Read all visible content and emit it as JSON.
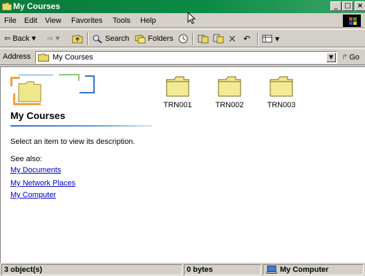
{
  "window": {
    "title": "My Courses"
  },
  "menu": [
    "File",
    "Edit",
    "View",
    "Favorites",
    "Tools",
    "Help"
  ],
  "toolbar": {
    "back": "Back",
    "search": "Search",
    "folders": "Folders"
  },
  "address": {
    "label": "Address",
    "value": "My Courses",
    "go": "Go"
  },
  "sidebar": {
    "title": "My Courses",
    "description": "Select an item to view its description.",
    "see_also": "See also:",
    "links": [
      "My Documents",
      "My Network Places",
      "My Computer"
    ]
  },
  "items": [
    {
      "label": "TRN001",
      "icon": "folder-icon"
    },
    {
      "label": "TRN002",
      "icon": "folder-icon"
    },
    {
      "label": "TRN003",
      "icon": "folder-icon"
    }
  ],
  "status": {
    "objects": "3 object(s)",
    "size": "0 bytes",
    "zone": "My Computer"
  },
  "colors": {
    "title_bar": "#0b8a44",
    "folder": "#f0e68c",
    "link": "#0000cc"
  }
}
